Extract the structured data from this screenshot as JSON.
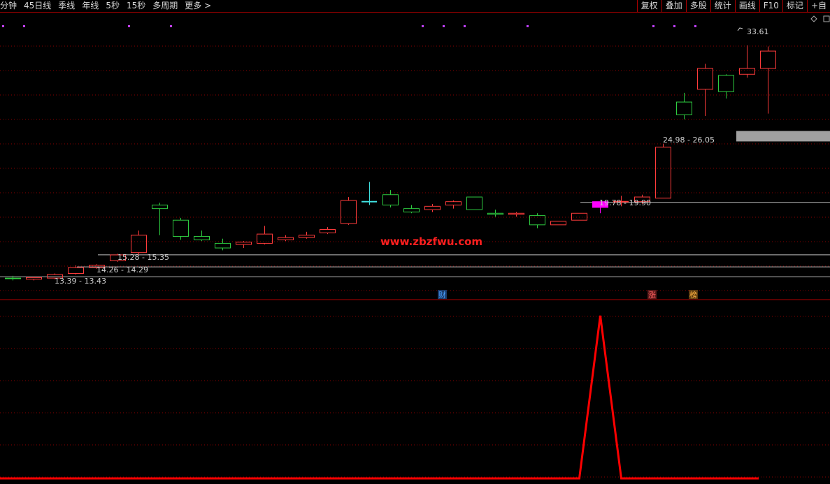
{
  "toolbar": {
    "left": [
      "分钟",
      "45日线",
      "季线",
      "年线",
      "5秒",
      "15秒",
      "多周期",
      "更多 >"
    ],
    "right": [
      "复权",
      "叠加",
      "多股",
      "统计",
      "画线",
      "F10",
      "标记",
      "+自"
    ]
  },
  "overlay_text": "www.zbzfwu.com",
  "event_markers": [
    "财",
    "涨",
    "榜"
  ],
  "colors": {
    "background": "#000000",
    "up": "#ff3b3b",
    "down": "#2ecc40",
    "doji_up": "#40e0e0",
    "grid": "#8b0000",
    "highlight": "#ff00ff",
    "gap_band": "#a0a0a0",
    "indicator": "#ff0000",
    "watermark": "#ff1f1f"
  },
  "chart_data": {
    "type": "candlestick",
    "price_axis": {
      "min": 11.5,
      "max": 35.5
    },
    "candles": [
      {
        "o": 13.3,
        "h": 13.5,
        "l": 13.1,
        "c": 13.3,
        "dir": "down"
      },
      {
        "o": 13.2,
        "h": 13.4,
        "l": 13.1,
        "c": 13.35,
        "dir": "up"
      },
      {
        "o": 13.3,
        "h": 13.7,
        "l": 13.2,
        "c": 13.6,
        "dir": "up"
      },
      {
        "o": 13.7,
        "h": 14.4,
        "l": 13.6,
        "c": 14.2,
        "dir": "up"
      },
      {
        "o": 14.2,
        "h": 14.5,
        "l": 14.1,
        "c": 14.4,
        "dir": "up"
      },
      {
        "o": 14.8,
        "h": 15.4,
        "l": 14.7,
        "c": 15.3,
        "dir": "up"
      },
      {
        "o": 15.5,
        "h": 17.4,
        "l": 15.3,
        "c": 17.0,
        "dir": "up"
      },
      {
        "o": 19.6,
        "h": 19.8,
        "l": 17.0,
        "c": 19.3,
        "dir": "down"
      },
      {
        "o": 18.3,
        "h": 18.5,
        "l": 16.6,
        "c": 16.9,
        "dir": "down"
      },
      {
        "o": 16.9,
        "h": 17.4,
        "l": 16.5,
        "c": 16.6,
        "dir": "down"
      },
      {
        "o": 16.3,
        "h": 16.7,
        "l": 15.7,
        "c": 15.9,
        "dir": "down"
      },
      {
        "o": 16.2,
        "h": 16.5,
        "l": 15.9,
        "c": 16.4,
        "dir": "up"
      },
      {
        "o": 16.3,
        "h": 17.8,
        "l": 16.2,
        "c": 17.1,
        "dir": "up"
      },
      {
        "o": 16.6,
        "h": 17.0,
        "l": 16.5,
        "c": 16.8,
        "dir": "up"
      },
      {
        "o": 16.8,
        "h": 17.3,
        "l": 16.7,
        "c": 17.0,
        "dir": "up"
      },
      {
        "o": 17.2,
        "h": 17.7,
        "l": 17.1,
        "c": 17.5,
        "dir": "up"
      },
      {
        "o": 18.0,
        "h": 20.3,
        "l": 17.9,
        "c": 20.0,
        "dir": "up"
      },
      {
        "o": 19.9,
        "h": 21.6,
        "l": 19.6,
        "c": 19.9,
        "dir": "doji"
      },
      {
        "o": 20.5,
        "h": 20.9,
        "l": 19.4,
        "c": 19.6,
        "dir": "down"
      },
      {
        "o": 19.3,
        "h": 19.6,
        "l": 18.9,
        "c": 19.0,
        "dir": "down"
      },
      {
        "o": 19.2,
        "h": 19.7,
        "l": 19.0,
        "c": 19.5,
        "dir": "up"
      },
      {
        "o": 19.6,
        "h": 20.0,
        "l": 19.3,
        "c": 19.9,
        "dir": "up"
      },
      {
        "o": 20.3,
        "h": 20.3,
        "l": 19.2,
        "c": 19.2,
        "dir": "down"
      },
      {
        "o": 18.9,
        "h": 19.2,
        "l": 18.6,
        "c": 18.8,
        "dir": "down"
      },
      {
        "o": 18.8,
        "h": 19.0,
        "l": 18.6,
        "c": 18.9,
        "dir": "up"
      },
      {
        "o": 18.7,
        "h": 18.9,
        "l": 17.6,
        "c": 17.9,
        "dir": "down"
      },
      {
        "o": 17.9,
        "h": 18.2,
        "l": 17.9,
        "c": 18.2,
        "dir": "up"
      },
      {
        "o": 18.3,
        "h": 18.9,
        "l": 18.3,
        "c": 18.9,
        "dir": "up"
      },
      {
        "o": 19.4,
        "h": 19.9,
        "l": 18.9,
        "c": 19.9,
        "dir": "highlight"
      },
      {
        "o": 19.9,
        "h": 20.4,
        "l": 19.5,
        "c": 19.9,
        "dir": "doji_red"
      },
      {
        "o": 19.9,
        "h": 20.5,
        "l": 19.7,
        "c": 20.3,
        "dir": "up"
      },
      {
        "o": 20.2,
        "h": 24.9,
        "l": 20.2,
        "c": 24.6,
        "dir": "up"
      },
      {
        "o": 27.4,
        "h": 29.3,
        "l": 27.0,
        "c": 28.5,
        "dir": "down"
      },
      {
        "o": 29.6,
        "h": 31.8,
        "l": 27.3,
        "c": 31.4,
        "dir": "up"
      },
      {
        "o": 29.4,
        "h": 30.9,
        "l": 28.8,
        "c": 30.8,
        "dir": "down"
      },
      {
        "o": 30.9,
        "h": 33.4,
        "l": 30.6,
        "c": 31.4,
        "dir": "up"
      },
      {
        "o": 31.4,
        "h": 33.3,
        "l": 27.5,
        "c": 32.9,
        "dir": "up"
      }
    ],
    "gap_labels": [
      "13.39 - 13.43",
      "14.26 - 14.29",
      "15.28 - 15.35",
      "19.78 - 19.90",
      "24.98 - 26.05"
    ],
    "peak_label": "33.61",
    "gap_zones": [
      {
        "from_index": 35,
        "price": 26.0,
        "price_to": 25.1
      }
    ],
    "support_lines": [
      13.41,
      14.27,
      15.31,
      19.84
    ],
    "indicator": {
      "peak_index": 28,
      "baseline": 0,
      "peak": 1
    }
  }
}
